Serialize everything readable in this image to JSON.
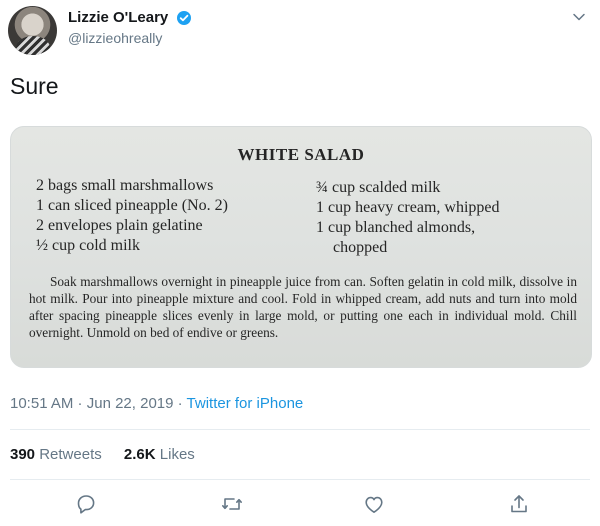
{
  "user": {
    "display_name": "Lizzie O'Leary",
    "handle": "@lizzieohreally",
    "verified_icon": "verified-badge-icon"
  },
  "tweet": {
    "text": "Sure"
  },
  "photo": {
    "title": "WHITE SALAD",
    "ingredients_left": [
      "2 bags small marshmallows",
      "1 can sliced pineapple (No. 2)",
      "2 envelopes plain gelatine",
      "½ cup cold milk"
    ],
    "ingredients_right": [
      "¾ cup scalded milk",
      "1 cup heavy cream, whipped",
      "1 cup blanched almonds,",
      "chopped"
    ],
    "instructions": "Soak marshmallows overnight in pineapple juice from can. Soften gelatin in cold milk, dissolve in hot milk. Pour into pineapple mixture and cool. Fold in whipped cream, add nuts and turn into mold after spacing pineapple slices evenly in large mold, or putting one each in individual mold. Chill overnight. Unmold on bed of endive or greens."
  },
  "meta": {
    "time": "10:51 AM",
    "separator1": " · ",
    "date": "Jun 22, 2019",
    "separator2": " · ",
    "source": "Twitter for iPhone"
  },
  "stats": {
    "retweets_count": "390",
    "retweets_label": "Retweets",
    "likes_count": "2.6K",
    "likes_label": "Likes"
  },
  "actions": {
    "reply_icon": "reply-icon",
    "retweet_icon": "retweet-icon",
    "like_icon": "heart-icon",
    "share_icon": "share-icon"
  },
  "colors": {
    "primary_text": "#14171a",
    "secondary_text": "#657786",
    "link": "#1b95e0",
    "verified": "#1da1f2"
  }
}
